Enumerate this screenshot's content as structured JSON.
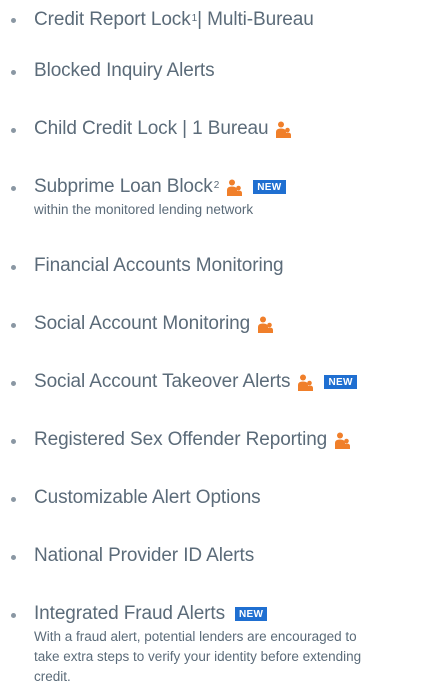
{
  "features": [
    {
      "label": "Credit Report Lock",
      "footnote": "1",
      "label_suffix": " | Multi-Bureau",
      "family": false,
      "is_new": false
    },
    {
      "label": "Blocked Inquiry Alerts",
      "footnote": "",
      "label_suffix": "",
      "family": false,
      "is_new": false
    },
    {
      "label": "Child Credit Lock | 1 Bureau",
      "footnote": "",
      "label_suffix": "",
      "family": true,
      "is_new": false
    },
    {
      "label": "Subprime Loan Block",
      "footnote": "2",
      "label_suffix": "",
      "family": true,
      "is_new": true,
      "description": "within the monitored lending network"
    },
    {
      "label": "Financial Accounts Monitoring",
      "footnote": "",
      "label_suffix": "",
      "family": false,
      "is_new": false
    },
    {
      "label": "Social Account Monitoring",
      "footnote": "",
      "label_suffix": "",
      "family": true,
      "is_new": false
    },
    {
      "label": "Social Account Takeover Alerts",
      "footnote": "",
      "label_suffix": "",
      "family": true,
      "is_new": true
    },
    {
      "label": "Registered Sex Offender Reporting",
      "footnote": "",
      "label_suffix": "",
      "family": true,
      "is_new": false
    },
    {
      "label": "Customizable Alert Options",
      "footnote": "",
      "label_suffix": "",
      "family": false,
      "is_new": false
    },
    {
      "label": "National Provider ID Alerts",
      "footnote": "",
      "label_suffix": "",
      "family": false,
      "is_new": false
    },
    {
      "label": "Integrated Fraud Alerts",
      "footnote": "",
      "label_suffix": "",
      "family": false,
      "is_new": true,
      "description": "With a fraud alert, potential lenders are encouraged to take extra steps to verify your identity before extending credit."
    }
  ],
  "badge": {
    "new_label": "NEW"
  },
  "icons": {
    "family": "family-icon"
  },
  "colors": {
    "text": "#5b6b79",
    "bullet": "#8a97a3",
    "family_icon": "#f07f2a",
    "badge_bg": "#1f6fd1",
    "badge_text": "#ffffff"
  }
}
